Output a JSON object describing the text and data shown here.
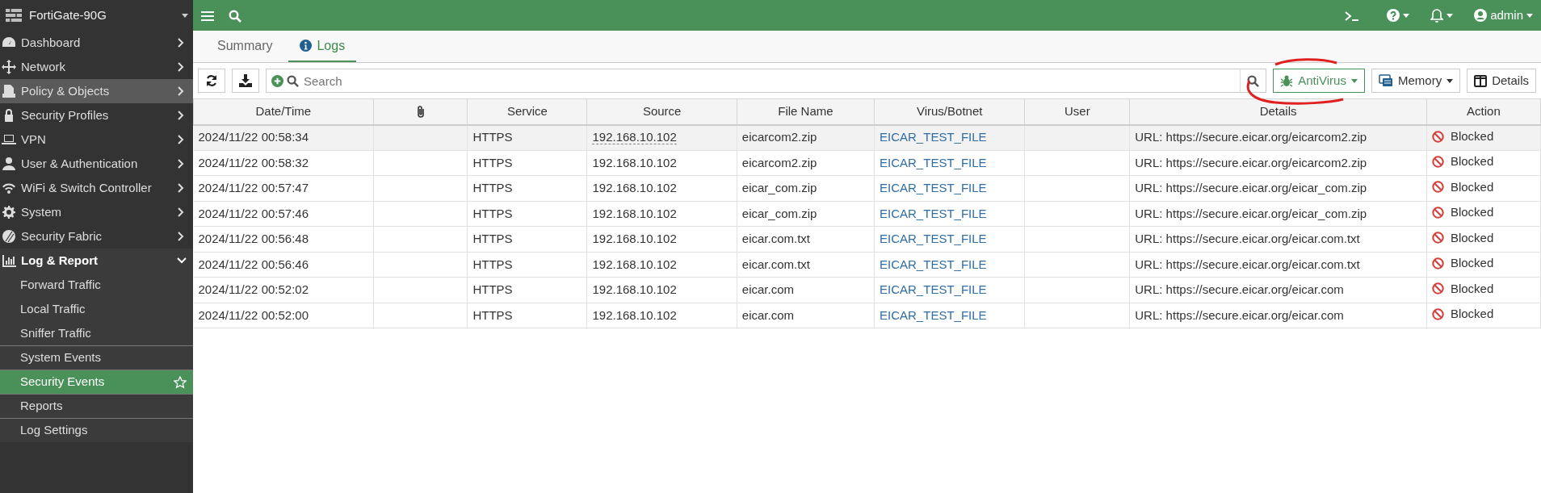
{
  "device": {
    "name": "FortiGate-90G"
  },
  "sidebar": {
    "items": [
      {
        "label": "Dashboard",
        "hovered": false,
        "expanded": false
      },
      {
        "label": "Network",
        "hovered": false,
        "expanded": false
      },
      {
        "label": "Policy & Objects",
        "hovered": true,
        "expanded": false
      },
      {
        "label": "Security Profiles",
        "hovered": false,
        "expanded": false
      },
      {
        "label": "VPN",
        "hovered": false,
        "expanded": false
      },
      {
        "label": "User & Authentication",
        "hovered": false,
        "expanded": false
      },
      {
        "label": "WiFi & Switch Controller",
        "hovered": false,
        "expanded": false
      },
      {
        "label": "System",
        "hovered": false,
        "expanded": false
      },
      {
        "label": "Security Fabric",
        "hovered": false,
        "expanded": false
      },
      {
        "label": "Log & Report",
        "hovered": false,
        "expanded": true,
        "children": [
          {
            "label": "Forward Traffic",
            "selected": false,
            "divider_before": false
          },
          {
            "label": "Local Traffic",
            "selected": false,
            "divider_before": false
          },
          {
            "label": "Sniffer Traffic",
            "selected": false,
            "divider_before": false
          },
          {
            "label": "System Events",
            "selected": false,
            "divider_before": true
          },
          {
            "label": "Security Events",
            "selected": true,
            "divider_before": true
          },
          {
            "label": "Reports",
            "selected": false,
            "divider_before": true
          },
          {
            "label": "Log Settings",
            "selected": false,
            "divider_before": true
          }
        ]
      }
    ]
  },
  "header": {
    "user": "admin"
  },
  "tabs": [
    {
      "label": "Summary",
      "selected": false
    },
    {
      "label": "Logs",
      "selected": true
    }
  ],
  "toolbar": {
    "search": {
      "placeholder": "Search"
    },
    "filters": [
      {
        "label": "AntiVirus",
        "active": true
      },
      {
        "label": "Memory",
        "active": false
      }
    ],
    "details_button": "Details"
  },
  "table": {
    "columns": [
      "Date/Time",
      "",
      "Service",
      "Source",
      "File Name",
      "Virus/Botnet",
      "User",
      "Details",
      "Action"
    ],
    "rows": [
      {
        "selected": true,
        "cells": [
          "2024/11/22 00:58:34",
          "",
          "HTTPS",
          "192.168.10.102",
          "eicarcom2.zip",
          "EICAR_TEST_FILE",
          "",
          "URL: https://secure.eicar.org/eicarcom2.zip",
          "Blocked"
        ]
      },
      {
        "selected": false,
        "cells": [
          "2024/11/22 00:58:32",
          "",
          "HTTPS",
          "192.168.10.102",
          "eicarcom2.zip",
          "EICAR_TEST_FILE",
          "",
          "URL: https://secure.eicar.org/eicarcom2.zip",
          "Blocked"
        ]
      },
      {
        "selected": false,
        "cells": [
          "2024/11/22 00:57:47",
          "",
          "HTTPS",
          "192.168.10.102",
          "eicar_com.zip",
          "EICAR_TEST_FILE",
          "",
          "URL: https://secure.eicar.org/eicar_com.zip",
          "Blocked"
        ]
      },
      {
        "selected": false,
        "cells": [
          "2024/11/22 00:57:46",
          "",
          "HTTPS",
          "192.168.10.102",
          "eicar_com.zip",
          "EICAR_TEST_FILE",
          "",
          "URL: https://secure.eicar.org/eicar_com.zip",
          "Blocked"
        ]
      },
      {
        "selected": false,
        "cells": [
          "2024/11/22 00:56:48",
          "",
          "HTTPS",
          "192.168.10.102",
          "eicar.com.txt",
          "EICAR_TEST_FILE",
          "",
          "URL: https://secure.eicar.org/eicar.com.txt",
          "Blocked"
        ]
      },
      {
        "selected": false,
        "cells": [
          "2024/11/22 00:56:46",
          "",
          "HTTPS",
          "192.168.10.102",
          "eicar.com.txt",
          "EICAR_TEST_FILE",
          "",
          "URL: https://secure.eicar.org/eicar.com.txt",
          "Blocked"
        ]
      },
      {
        "selected": false,
        "cells": [
          "2024/11/22 00:52:02",
          "",
          "HTTPS",
          "192.168.10.102",
          "eicar.com",
          "EICAR_TEST_FILE",
          "",
          "URL: https://secure.eicar.org/eicar.com",
          "Blocked"
        ]
      },
      {
        "selected": false,
        "cells": [
          "2024/11/22 00:52:00",
          "",
          "HTTPS",
          "192.168.10.102",
          "eicar.com",
          "EICAR_TEST_FILE",
          "",
          "URL: https://secure.eicar.org/eicar.com",
          "Blocked"
        ]
      }
    ]
  }
}
